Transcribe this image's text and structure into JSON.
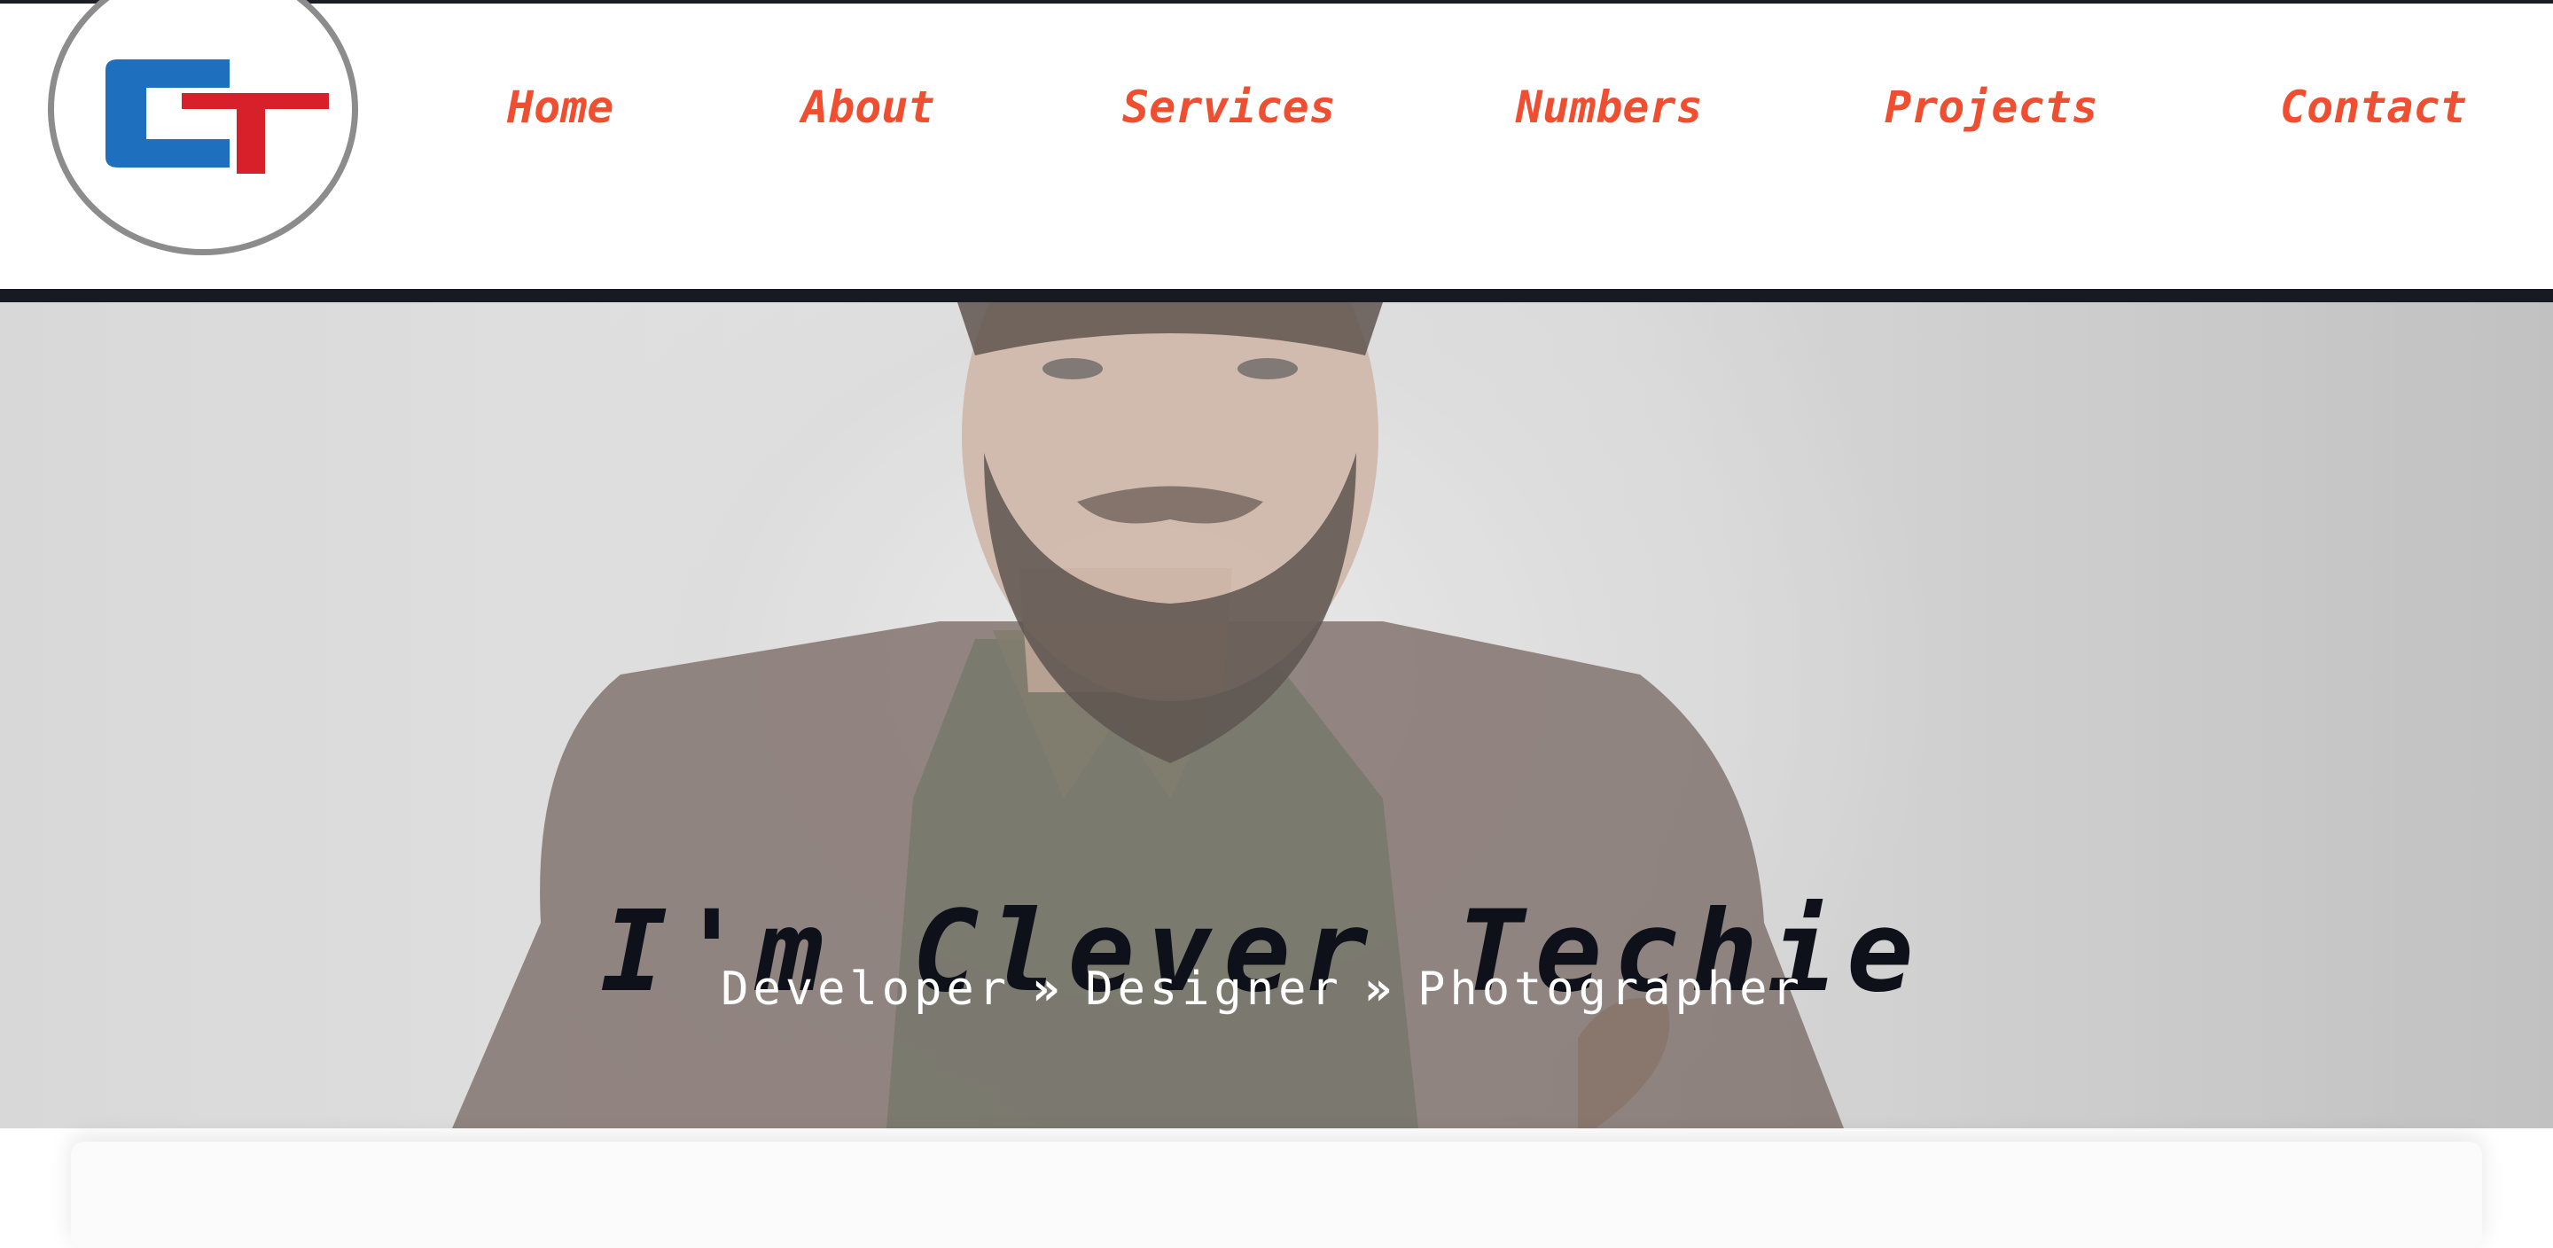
{
  "header": {
    "logo": {
      "text": "CT",
      "colors": {
        "c": "#1f6fbf",
        "t": "#d8202a",
        "ring": "#8c8c8c"
      }
    },
    "nav": {
      "color": "#f04e30",
      "items": [
        {
          "label": "Home"
        },
        {
          "label": "About"
        },
        {
          "label": "Services"
        },
        {
          "label": "Numbers"
        },
        {
          "label": "Projects"
        },
        {
          "label": "Contact"
        }
      ]
    }
  },
  "hero": {
    "background_image": "portrait-photo-bearded-man-brown-jacket",
    "title": "I'm Clever Techie",
    "subtitle": {
      "roles": [
        "Developer",
        "Designer",
        "Photographer"
      ],
      "separator_icon": "double-chevron-right-icon",
      "separator_glyph": "»"
    }
  }
}
